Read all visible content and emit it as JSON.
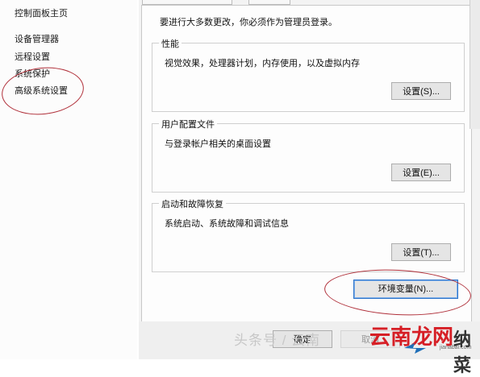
{
  "left_panel": {
    "home_label": "控制面板主页",
    "items": [
      {
        "label": "设备管理器"
      },
      {
        "label": "远程设置"
      },
      {
        "label": "系统保护"
      },
      {
        "label": "高级系统设置"
      }
    ]
  },
  "dialog": {
    "notice": "要进行大多数更改，你必须作为管理员登录。",
    "groups": [
      {
        "title": "性能",
        "description": "视觉效果，处理器计划，内存使用，以及虚拟内存",
        "button": "设置(S)..."
      },
      {
        "title": "用户配置文件",
        "description": "与登录帐户相关的桌面设置",
        "button": "设置(E)..."
      },
      {
        "title": "启动和故障恢复",
        "description": "系统启动、系统故障和调试信息",
        "button": "设置(T)..."
      }
    ],
    "env_button": "环境变量(N)...",
    "ok_button": "确定",
    "cancel_button": "取消"
  },
  "watermark": {
    "text": "头条号 / 云南",
    "brand": "云南龙网",
    "domain": "jianabai.com",
    "side_text": "纳菜"
  },
  "colors": {
    "annotation_red": "#b0303a",
    "brand_red": "#d61f26",
    "focus_blue": "#2e74c9"
  }
}
